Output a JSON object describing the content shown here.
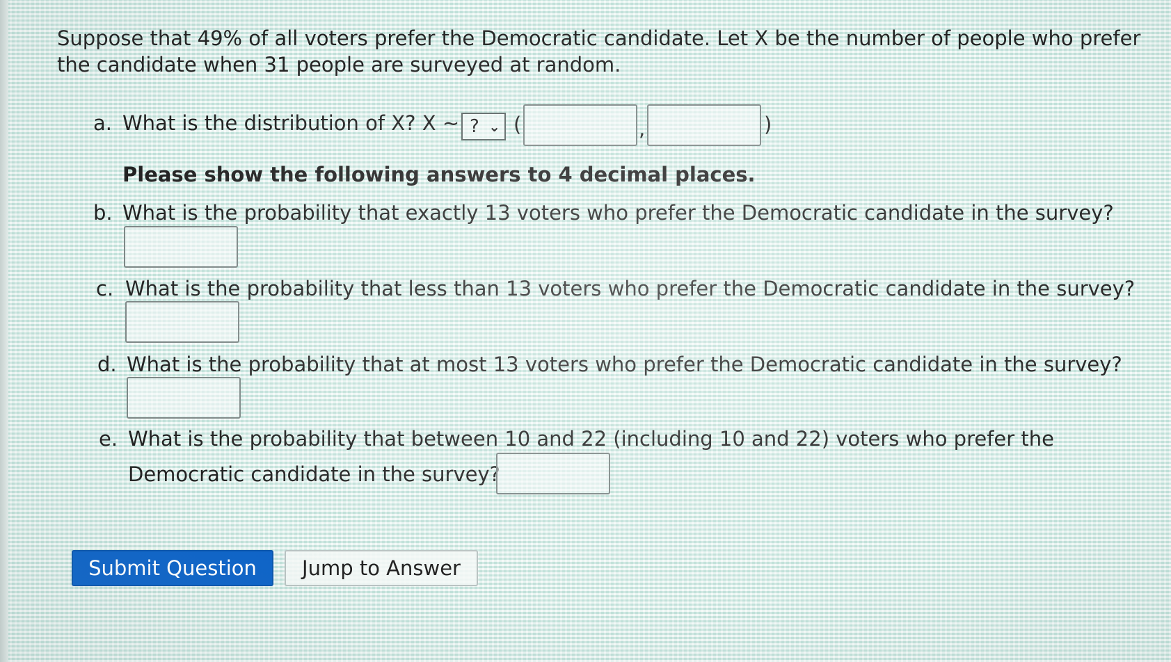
{
  "question": {
    "intro": "Suppose that 49% of all voters prefer the Democratic candidate. Let X be the number of people who prefer the candidate when 31 people are surveyed at random.",
    "note": "Please show the following answers to 4 decimal places.",
    "parts": {
      "a": {
        "letter": "a.",
        "text": "What is the distribution of X? X ~",
        "select_value": "?"
      },
      "b": {
        "letter": "b.",
        "text": "What is the probability that exactly 13 voters who prefer the Democratic candidate in the survey?"
      },
      "c": {
        "letter": "c.",
        "text": "What is the probability that less than 13 voters who prefer the Democratic candidate in the survey?"
      },
      "d": {
        "letter": "d.",
        "text": "What is the probability that at most 13 voters who prefer the Democratic candidate in the survey?"
      },
      "e": {
        "letter": "e.",
        "text_line1": "What is the probability that between 10 and 22 (including 10 and 22) voters who prefer the",
        "text_line2": "Democratic candidate in the survey?"
      }
    }
  },
  "symbols": {
    "open_paren": "(",
    "comma": ",",
    "close_paren": ")"
  },
  "buttons": {
    "submit": "Submit Question",
    "jump": "Jump to Answer"
  },
  "colors": {
    "primary": "#0e64c8",
    "text": "#222222"
  },
  "icons": {
    "select": "chevron-down-icon"
  }
}
